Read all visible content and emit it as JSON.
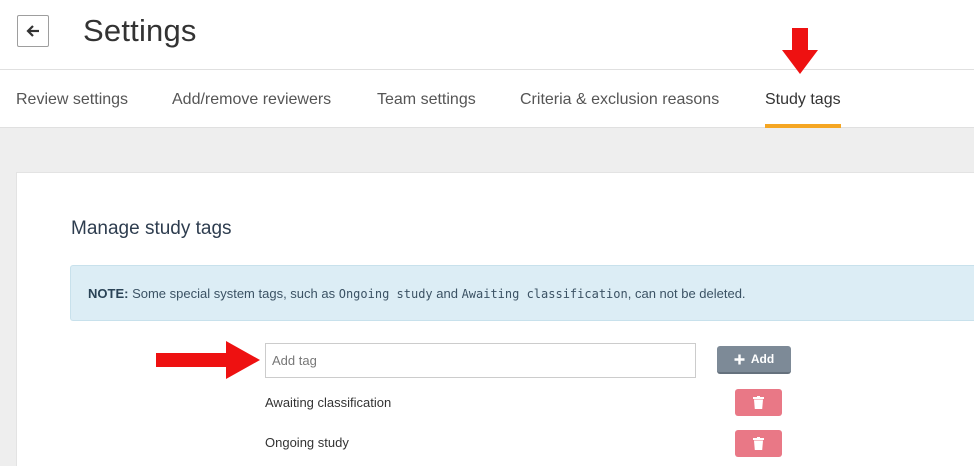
{
  "header": {
    "back_icon": "arrow-left-icon",
    "title": "Settings"
  },
  "tabs": [
    {
      "label": "Review settings",
      "active": false
    },
    {
      "label": "Add/remove reviewers",
      "active": false
    },
    {
      "label": "Team settings",
      "active": false
    },
    {
      "label": "Criteria & exclusion reasons",
      "active": false
    },
    {
      "label": "Study tags",
      "active": true
    }
  ],
  "colors": {
    "active_tab_underline": "#f5a623",
    "note_background": "#dcedf5",
    "add_button": "#7d8a97",
    "delete_button": "#e97886",
    "annotation_arrow": "#ee1111"
  },
  "main": {
    "section_title": "Manage study tags",
    "note": {
      "label": "NOTE:",
      "text_before": " Some special system tags, such as ",
      "code_1": "Ongoing study",
      "text_middle": " and ",
      "code_2": "Awaiting classification",
      "text_after": ", can not be deleted."
    },
    "add_tag": {
      "value": "",
      "placeholder": "Add tag",
      "button_label": "Add",
      "button_icon": "plus-icon"
    },
    "tags": [
      {
        "label": "Awaiting classification",
        "delete_icon": "trash-icon"
      },
      {
        "label": "Ongoing study",
        "delete_icon": "trash-icon"
      }
    ]
  },
  "annotations": [
    {
      "type": "arrow-down",
      "points_to": "Study tags tab"
    },
    {
      "type": "arrow-right",
      "points_to": "Add tag input"
    }
  ]
}
